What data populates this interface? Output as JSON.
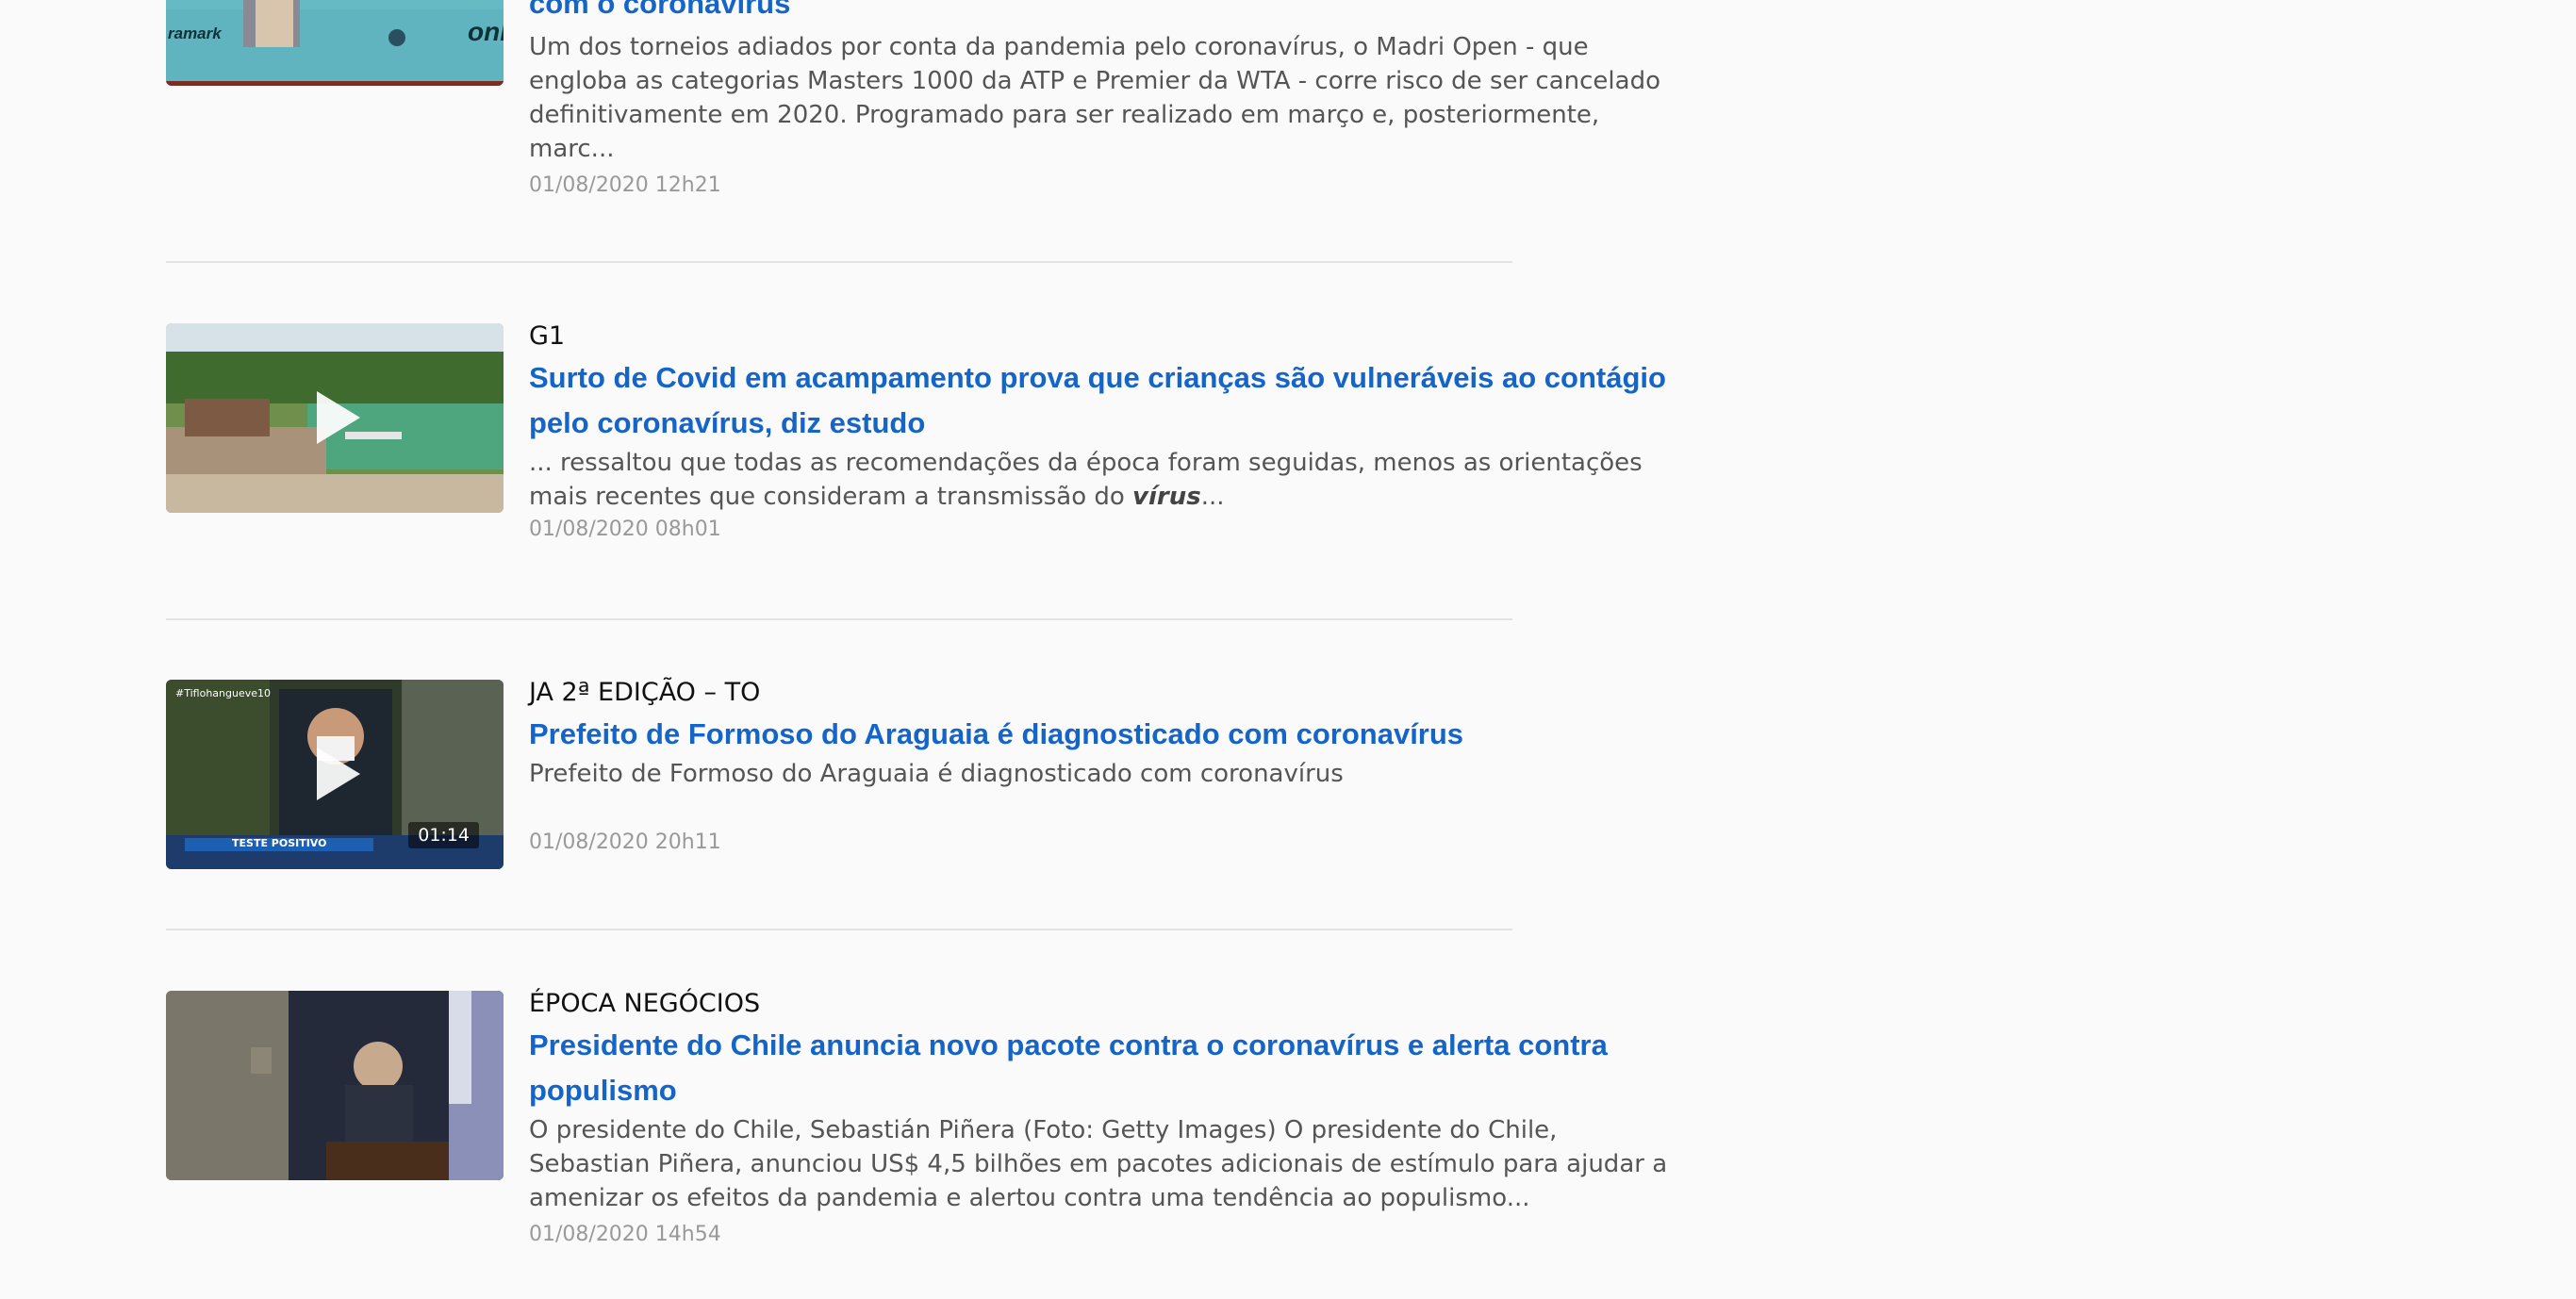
{
  "items": [
    {
      "source": "",
      "title": "com o coronavírus",
      "summary": "Um dos torneios adiados por conta da pandemia pelo coronavírus, o Madri Open - que engloba as categorias Masters 1000 da ATP e Premier da WTA - corre risco de ser cancelado definitivamente em 2020. Programado para ser realizado em março e, posteriormente, marc...",
      "date": "01/08/2020 12h21",
      "thumb_text": [
        "ramark",
        "onl"
      ],
      "is_video": false
    },
    {
      "source": "G1",
      "title": "Surto de Covid em acampamento prova que crianças são vulneráveis ao contágio pelo coronavírus, diz estudo",
      "summary_prefix": "... ressaltou que todas as recomendações da época foram seguidas, menos as orientações mais recentes que consideram a transmissão do ",
      "summary_em": "vírus",
      "summary_suffix": "...",
      "date": "01/08/2020 08h01",
      "is_video": true
    },
    {
      "source": "JA 2ª EDIÇÃO – TO",
      "title": "Prefeito de Formoso do Araguaia é diagnosticado com coronavírus",
      "summary": "Prefeito de Formoso do Araguaia é diagnosticado com coronavírus",
      "date": "01/08/2020 20h11",
      "is_video": true,
      "duration": "01:14",
      "thumb_text": [
        "#Tiflohangueve10",
        "TESTE POSITIVO"
      ]
    },
    {
      "source": "ÉPOCA NEGÓCIOS",
      "title": "Presidente do Chile anuncia novo pacote contra o coronavírus e alerta contra populismo",
      "summary": "O presidente do Chile, Sebastián Piñera (Foto: Getty Images)   O presidente do Chile, Sebastian Piñera, anunciou US$ 4,5 bilhões em pacotes adicionais de estímulo para ajudar a amenizar os efeitos da pandemia e alertou contra uma tendência ao populismo...",
      "date": "01/08/2020 14h54",
      "is_video": false
    }
  ],
  "colors": {
    "background": "#fafafa",
    "title_link": "#1565c8",
    "source_text": "#111111",
    "summary_text": "#555555",
    "date_text": "#999999",
    "divider": "#e2e2e2"
  }
}
